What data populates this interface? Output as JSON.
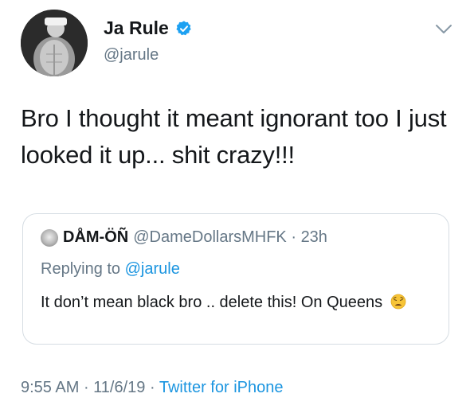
{
  "author": {
    "display_name": "Ja Rule",
    "handle": "@jarule",
    "verified": true,
    "avatar_icon": "profile-photo"
  },
  "tweet": {
    "text": "Bro I thought it meant ignorant too I just looked it up... shit crazy!!!"
  },
  "quoted_tweet": {
    "display_name": "DÅM-ÖÑ",
    "handle": "@DameDollarsMHFK",
    "separator": " · ",
    "time_ago": "23h",
    "replying_prefix": "Replying to ",
    "replying_to": "@jarule",
    "text": "It don’t mean black bro .. delete this! On Queens",
    "emoji": "weary-face"
  },
  "footer": {
    "time": "9:55 AM",
    "separator1": " · ",
    "date": "11/6/19",
    "separator2": " · ",
    "source": "Twitter for iPhone"
  },
  "colors": {
    "text": "#14171a",
    "muted": "#657786",
    "link": "#1b95e0",
    "verified": "#1da1f2",
    "border": "#d6dde3"
  },
  "icons": [
    "verified-badge-icon",
    "chevron-down-icon",
    "weary-face-emoji-icon"
  ]
}
